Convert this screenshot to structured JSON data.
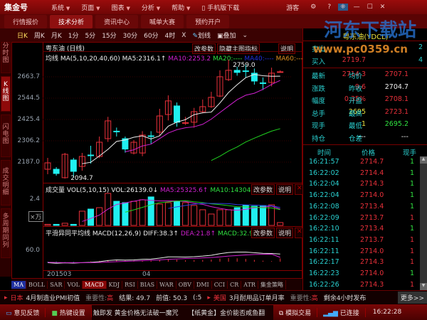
{
  "app": {
    "title": "集金号",
    "menus": [
      "系统",
      "页面",
      "图表",
      "分析",
      "帮助"
    ],
    "mobile": "手机版下载",
    "user": "游客"
  },
  "tabs": [
    "行情报价",
    "技术分析",
    "资讯中心",
    "喊单大赛",
    "预约开户"
  ],
  "toolbar": {
    "periods": [
      "日K",
      "周K",
      "月K",
      "1分",
      "5分",
      "15分",
      "30分",
      "60分",
      "4时",
      "X"
    ],
    "draw": "划线",
    "overlay": "叠加"
  },
  "left_tabs": [
    "分时图",
    "K线图",
    "闪电图",
    "成交明细",
    "多周期同列"
  ],
  "main": {
    "symbol_title": "粤东油 (日线)",
    "btn_params": "改参数",
    "btn_hide": "隐藏主图指标",
    "btn_help": "说明",
    "ma_label": "均线 MA(5,10,20,40,60)",
    "ma5": "MA5:2316.1↑",
    "ma10": "MA10:2253.2",
    "ma20": "MA20:----",
    "ma40": "MA40:----",
    "ma60": "MA60:----",
    "yticks": [
      "2663.7",
      "2544.5",
      "2425.4",
      "2306.2",
      "2187.0"
    ],
    "high_label": "2759.0",
    "low_label": "2094.7"
  },
  "vol": {
    "label": "成交量 VOL(5,10,15)",
    "vol": "VOL:26139.0↓",
    "ma5": "MA5:25325.6↑",
    "ma10": "MA10:14304.9",
    "ytick": "2.4",
    "unit": "×万",
    "btn_params": "改参数",
    "btn_help": "说明"
  },
  "macd": {
    "label": "平滑异同平均线 MACD(12,26,9)",
    "diff": "DIFF:38.3↑",
    "dea": "DEA:21.8↑",
    "macd": "MACD:32.9↓",
    "ytick": "60.0",
    "btn_params": "改参数",
    "btn_help": "说明"
  },
  "dates": [
    "201503",
    "04"
  ],
  "indicators": [
    "MA",
    "BOLL",
    "SAR",
    "VOL",
    "MACD",
    "KDJ",
    "RSI",
    "BIAS",
    "WAR",
    "OBV",
    "DMI",
    "CCI",
    "CR",
    "ATR",
    "集金策略"
  ],
  "chart_data": {
    "type": "candlestick",
    "colors": {
      "up": "#e8303a",
      "down": "#20f0f0"
    },
    "ohlc": [
      [
        2147.2,
        2182.9,
        2210.8,
        2119.4
      ],
      [
        2147.2,
        2123.4,
        2159.1,
        2111.4
      ],
      [
        2100,
        2230.6,
        2238.6,
        2094.7
      ],
      [
        2198.9,
        2135.3,
        2210.8,
        2099.5
      ],
      [
        2163.1,
        2218.7,
        2238.6,
        2139.3
      ],
      [
        2226.7,
        2222.7,
        2278.3,
        2179
      ],
      [
        2218.7,
        2298.2,
        2330,
        2210
      ],
      [
        2318,
        2417.4,
        2440,
        2300
      ],
      [
        2360,
        2356,
        2380,
        2330
      ],
      [
        2318,
        2260,
        2330,
        2240
      ],
      [
        2238,
        2298,
        2310,
        2230
      ],
      [
        2238,
        2338,
        2360,
        2220
      ],
      [
        2334,
        2330,
        2360,
        2290
      ],
      [
        2354,
        2445,
        2485,
        2335
      ],
      [
        2453,
        2529,
        2560,
        2420
      ],
      [
        2501,
        2410,
        2520,
        2385
      ],
      [
        2403,
        2408,
        2440,
        2395
      ],
      [
        2410,
        2469,
        2490,
        2380
      ],
      [
        2469,
        2497,
        2537,
        2460
      ],
      [
        2497,
        2549,
        2580,
        2490
      ],
      [
        2556,
        2664,
        2700,
        2550
      ],
      [
        2648,
        2700,
        2759,
        2640
      ],
      [
        2700,
        2688,
        2720,
        2670
      ],
      [
        2697,
        2694,
        2730,
        2660
      ],
      [
        2684,
        2640,
        2710,
        2620
      ],
      [
        2630,
        2627,
        2660,
        2590
      ],
      [
        2632,
        2684,
        2715,
        2610
      ],
      [
        2690,
        2692,
        2700,
        2688
      ]
    ],
    "volume": [
      0.1,
      0.1,
      0.2,
      0.1,
      1.3,
      1.49,
      1.62,
      2.92,
      2.2,
      2.08,
      2.2,
      2.34,
      2.6,
      1.95,
      2.08,
      2.2,
      2.08,
      1.82,
      1.43,
      1.04,
      1.43,
      1.43,
      1.62,
      1.82,
      1.75,
      1.75,
      1.88,
      0.26
    ],
    "diff": [
      -5,
      -8,
      -6,
      -7,
      -5,
      -3,
      0,
      6,
      9,
      8,
      9,
      12,
      13,
      18,
      24,
      24,
      23,
      25,
      28,
      32,
      40,
      46,
      48,
      48,
      45,
      42,
      41,
      38.3
    ],
    "dea": [
      -3,
      -4,
      -5,
      -5,
      -5,
      -5,
      -4,
      -2,
      0,
      2,
      3,
      5,
      7,
      9,
      12,
      14,
      16,
      17,
      19,
      21,
      24,
      28,
      31,
      34,
      36,
      37,
      38,
      21.8
    ]
  },
  "quote": {
    "title": "粤东油(YDCL)",
    "sell": {
      "label": "卖出",
      "price": "",
      "qty": "2"
    },
    "buy": {
      "label": "买入",
      "price": "2719.7",
      "qty": "4"
    },
    "rows": [
      [
        {
          "l": "最新",
          "v": "2714.3",
          "c": "rd"
        },
        {
          "l": "均价",
          "v": "2707.1",
          "c": "rd"
        }
      ],
      [
        {
          "l": "涨跌",
          "v": "9.6",
          "c": "rd"
        },
        {
          "l": "昨收",
          "v": "2704.7",
          "c": "wh"
        }
      ],
      [
        {
          "l": "幅度",
          "v": "0.35%",
          "c": "rd"
        },
        {
          "l": "开盘",
          "v": "2708.1",
          "c": "rd"
        }
      ],
      [
        {
          "l": "总手",
          "v": "2695",
          "c": "yl"
        },
        {
          "l": "最高",
          "v": "2723.1",
          "c": "rd"
        }
      ],
      [
        {
          "l": "现手",
          "v": "1",
          "c": "yl"
        },
        {
          "l": "最低",
          "v": "2695.2",
          "c": "gr"
        }
      ],
      [
        {
          "l": "持仓",
          "v": "---",
          "c": "wh"
        },
        {
          "l": "仓差",
          "v": "---",
          "c": "wh"
        }
      ]
    ]
  },
  "ticks": {
    "headers": [
      "时间",
      "价格",
      "现手"
    ],
    "rows": [
      [
        "16:21:57",
        "2714.7",
        "1",
        "gr"
      ],
      [
        "16:22:02",
        "2714.4",
        "1",
        "gr"
      ],
      [
        "16:22:04",
        "2714.3",
        "1",
        "gr"
      ],
      [
        "16:22:04",
        "2714.0",
        "1",
        "gr"
      ],
      [
        "16:22:08",
        "2713.4",
        "1",
        "gr"
      ],
      [
        "16:22:09",
        "2713.7",
        "1",
        "rd"
      ],
      [
        "16:22:10",
        "2713.4",
        "1",
        "gr"
      ],
      [
        "16:22:11",
        "2713.7",
        "1",
        "rd"
      ],
      [
        "16:22:11",
        "2714.0",
        "1",
        "rd"
      ],
      [
        "16:22:17",
        "2714.3",
        "1",
        "rd"
      ],
      [
        "16:22:23",
        "2714.0",
        "1",
        "gr"
      ],
      [
        "16:22:26",
        "2714.3",
        "1",
        "rd"
      ]
    ]
  },
  "news": {
    "c1": "日本",
    "t1": "4月制造业PMI初值",
    "imp1": "重要性:",
    "lvl1": "高",
    "res": "结果: 49.7",
    "prev": "前值: 50.3",
    "extra": "(:5",
    "c2": "美国",
    "t2": "3月耐用品订单月率",
    "imp2": "重要性:",
    "lvl2": "高",
    "remain": "剩余4小时发布",
    "more": "更多>>"
  },
  "status": {
    "feedback": "意见反馈",
    "hotkey": "热键设置",
    "scroll": "触即发 黄金价格无法破一魔咒　　【纸黄金】金价能否咸鱼翻",
    "sim": "模拟交易",
    "conn": "已连接",
    "time": "16:22:28"
  },
  "watermark": {
    "name": "河东下载站",
    "url": "www.pc0359.cn"
  }
}
